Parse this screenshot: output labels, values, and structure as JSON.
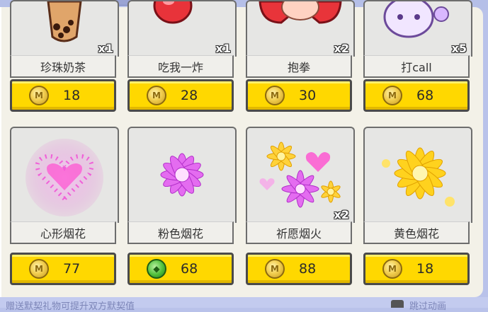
{
  "shop": {
    "items": [
      {
        "name": "珍珠奶茶",
        "price": "18",
        "qty": "x1",
        "currency": "coin-icon",
        "art": "bubble-tea-icon"
      },
      {
        "name": "吃我一炸",
        "price": "28",
        "qty": "x1",
        "currency": "coin-icon",
        "art": "bomb-icon"
      },
      {
        "name": "抱拳",
        "price": "30",
        "qty": "x2",
        "currency": "coin-icon",
        "art": "fist-salute-icon"
      },
      {
        "name": "打call",
        "price": "68",
        "qty": "x5",
        "currency": "coin-icon",
        "art": "cheer-icon"
      },
      {
        "name": "心形烟花",
        "price": "77",
        "qty": "",
        "currency": "coin-icon",
        "art": "heart-firework-icon"
      },
      {
        "name": "粉色烟花",
        "price": "68",
        "qty": "",
        "currency": "gem-icon",
        "art": "pink-firework-icon"
      },
      {
        "name": "祈愿烟火",
        "price": "88",
        "qty": "x2",
        "currency": "coin-icon",
        "art": "wish-firework-icon"
      },
      {
        "name": "黄色烟花",
        "price": "18",
        "qty": "",
        "currency": "coin-icon",
        "art": "yellow-firework-icon"
      }
    ]
  },
  "footer": {
    "hint": "赠送默契礼物可提升双方默契值",
    "skip_label": "跳过动画"
  },
  "colors": {
    "price_bg": "#ffd800",
    "panel_bg": "#f3f1e8",
    "coin": "#f2cf52",
    "gem": "#4fbf3a"
  }
}
